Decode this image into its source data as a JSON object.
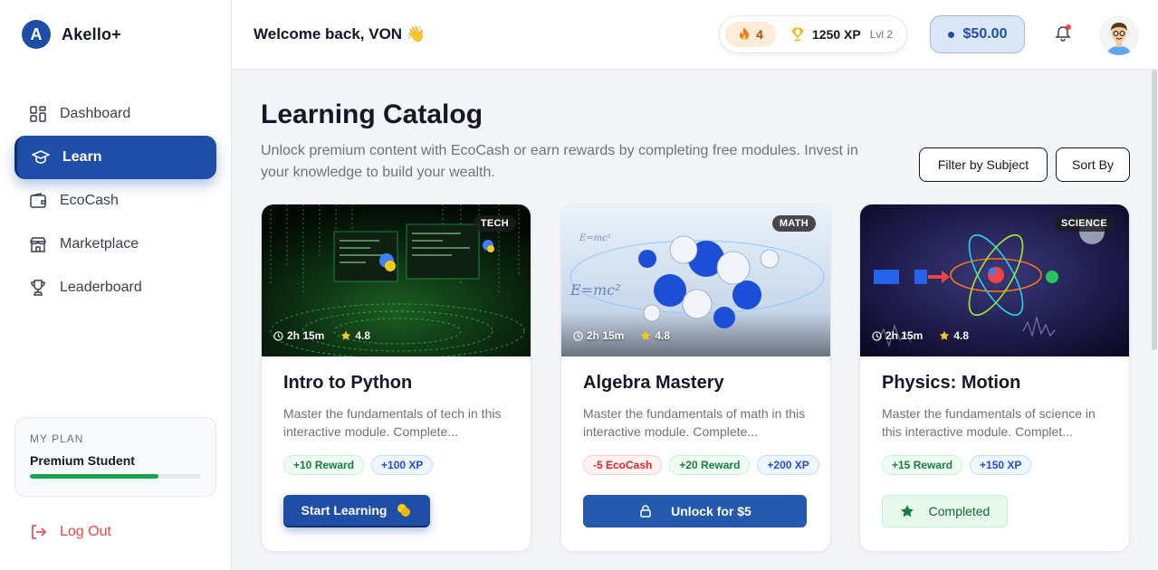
{
  "brand": {
    "logo_letter": "A",
    "name": "Akello+"
  },
  "sidebar": {
    "items": [
      {
        "label": "Dashboard",
        "icon": "grid-icon",
        "active": false
      },
      {
        "label": "Learn",
        "icon": "graduation-cap-icon",
        "active": true
      },
      {
        "label": "EcoCash",
        "icon": "wallet-icon",
        "active": false
      },
      {
        "label": "Marketplace",
        "icon": "store-icon",
        "active": false
      },
      {
        "label": "Leaderboard",
        "icon": "trophy-icon",
        "active": false
      }
    ],
    "plan": {
      "label": "MY PLAN",
      "name": "Premium Student",
      "progress": 0.75
    },
    "logout_label": "Log Out"
  },
  "header": {
    "welcome": "Welcome back, VON 👋",
    "streak": "4",
    "xp": "1250 XP",
    "level": "Lvl 2",
    "balance": "$50.00"
  },
  "main": {
    "title": "Learning Catalog",
    "subtitle": "Unlock premium content with EcoCash or earn rewards by completing free modules. Invest in your knowledge to build your wealth.",
    "filter_label": "Filter by Subject",
    "sort_label": "Sort By"
  },
  "courses": [
    {
      "badge": "TECH",
      "duration": "2h 15m",
      "rating": "4.8",
      "title": "Intro to Python",
      "description": "Master the fundamentals of tech in this interactive module. Complete...",
      "tags": [
        "+10 Reward",
        "+100 XP"
      ],
      "button": "Start Learning"
    },
    {
      "badge": "MATH",
      "duration": "2h 15m",
      "rating": "4.8",
      "title": "Algebra Mastery",
      "description": "Master the fundamentals of math in this interactive module. Complete...",
      "tags": [
        "-5 EcoCash",
        "+20 Reward",
        "+200 XP"
      ],
      "button": "Unlock for $5"
    },
    {
      "badge": "SCIENCE",
      "duration": "2h 15m",
      "rating": "4.8",
      "title": "Physics: Motion",
      "description": "Master the fundamentals of science in this interactive module. Complet...",
      "tags": [
        "+15 Reward",
        "+150 XP"
      ],
      "button": "Completed"
    }
  ],
  "colors": {
    "primary": "#1e4ea8",
    "danger": "#ef4444",
    "success": "#16a34a"
  }
}
